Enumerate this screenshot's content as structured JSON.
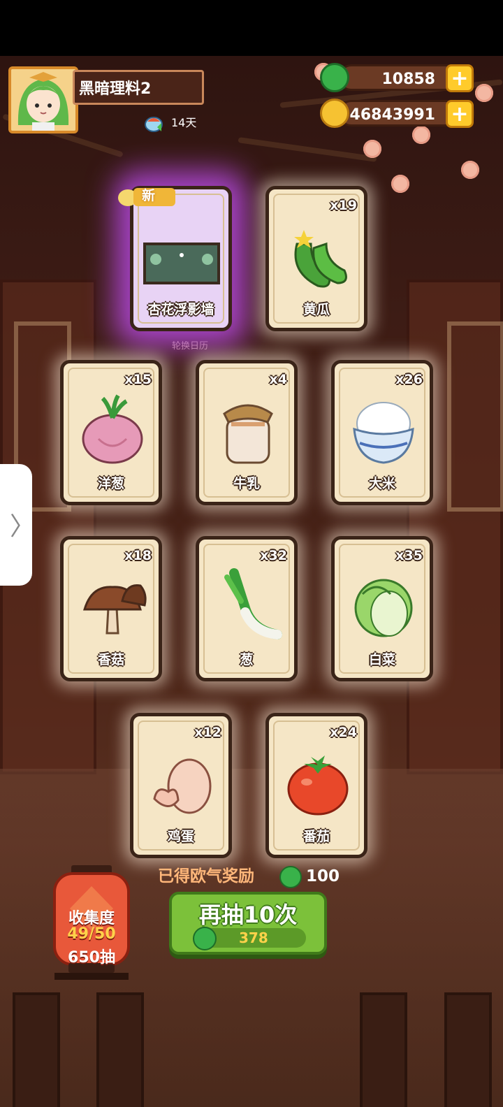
{
  "player": {
    "name": "黑暗理料2",
    "days": "14天"
  },
  "currency": {
    "jade": "10858",
    "gold": "46843991"
  },
  "new_badge": "新",
  "rotate_label": "轮换日历",
  "cards": [
    {
      "label": "杏花浮影墙",
      "count": "",
      "icon": "wall-decor-icon"
    },
    {
      "label": "黄瓜",
      "count": "x19",
      "icon": "cucumber-icon"
    },
    {
      "label": "洋葱",
      "count": "x15",
      "icon": "onion-icon"
    },
    {
      "label": "牛乳",
      "count": "x4",
      "icon": "milk-jar-icon"
    },
    {
      "label": "大米",
      "count": "x26",
      "icon": "rice-bowl-icon"
    },
    {
      "label": "香菇",
      "count": "x18",
      "icon": "mushroom-icon"
    },
    {
      "label": "葱",
      "count": "x32",
      "icon": "scallion-icon"
    },
    {
      "label": "白菜",
      "count": "x35",
      "icon": "cabbage-icon"
    },
    {
      "label": "鸡蛋",
      "count": "x12",
      "icon": "egg-icon"
    },
    {
      "label": "番茄",
      "count": "x24",
      "icon": "tomato-icon"
    }
  ],
  "collection": {
    "title": "收集度",
    "progress": "49/50",
    "draws": "650抽"
  },
  "bonus": {
    "label": "已得欧气奖励",
    "value": "100"
  },
  "draw_button": {
    "label": "再抽10次",
    "cost": "378"
  },
  "colors": {
    "jade": "#39b24a",
    "gold": "#ffcb2b",
    "button": "#7cc13a",
    "lantern": "#e8583a"
  }
}
